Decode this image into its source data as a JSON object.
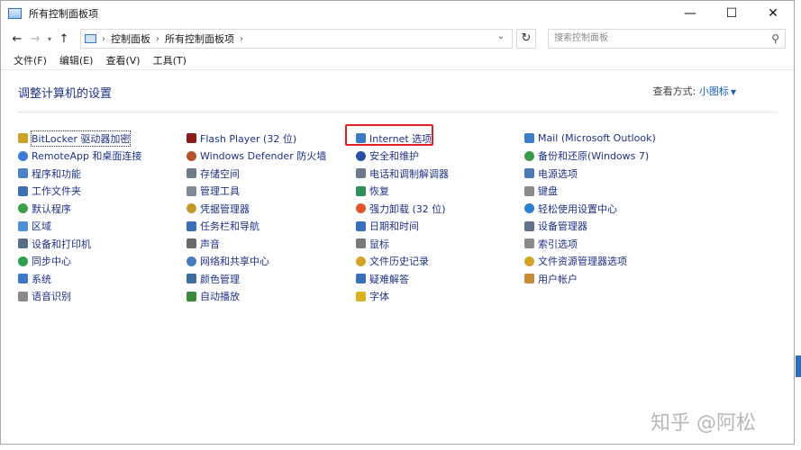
{
  "window": {
    "title": "所有控制面板项"
  },
  "nav": {
    "breadcrumb": [
      "控制面板",
      "所有控制面板项"
    ],
    "search_placeholder": "搜索控制面板"
  },
  "menu": [
    "文件(F)",
    "编辑(E)",
    "查看(V)",
    "工具(T)"
  ],
  "main": {
    "heading": "调整计算机的设置",
    "view_by_label": "查看方式:",
    "view_by_value": "小图标"
  },
  "columns": [
    [
      "BitLocker 驱动器加密",
      "RemoteApp 和桌面连接",
      "程序和功能",
      "工作文件夹",
      "默认程序",
      "区域",
      "设备和打印机",
      "同步中心",
      "系统",
      "语音识别"
    ],
    [
      "Flash Player (32 位)",
      "Windows Defender 防火墙",
      "存储空间",
      "管理工具",
      "凭据管理器",
      "任务栏和导航",
      "声音",
      "网络和共享中心",
      "颜色管理",
      "自动播放"
    ],
    [
      "Internet 选项",
      "安全和维护",
      "电话和调制解调器",
      "恢复",
      "强力卸载 (32 位)",
      "日期和时间",
      "鼠标",
      "文件历史记录",
      "疑难解答",
      "字体"
    ],
    [
      "Mail (Microsoft Outlook)",
      "备份和还原(Windows 7)",
      "电源选项",
      "键盘",
      "轻松使用设置中心",
      "设备管理器",
      "索引选项",
      "文件资源管理器选项",
      "用户帐户"
    ]
  ],
  "icons": [
    [
      "bitlocker-icon",
      "remoteapp-icon",
      "programs-icon",
      "work-folders-icon",
      "default-programs-icon",
      "region-icon",
      "devices-printers-icon",
      "sync-center-icon",
      "system-icon",
      "speech-recognition-icon"
    ],
    [
      "flash-icon",
      "firewall-icon",
      "storage-spaces-icon",
      "admin-tools-icon",
      "credential-icon",
      "taskbar-icon",
      "sound-icon",
      "network-icon",
      "color-management-icon",
      "autoplay-icon"
    ],
    [
      "internet-options-icon",
      "security-flag-icon",
      "phone-modem-icon",
      "recovery-icon",
      "uninstall-icon",
      "clock-icon",
      "mouse-icon",
      "file-history-icon",
      "troubleshoot-icon",
      "fonts-icon"
    ],
    [
      "mail-icon",
      "backup-icon",
      "power-icon",
      "keyboard-icon",
      "ease-of-access-icon",
      "device-manager-icon",
      "index-options-icon",
      "folder-options-icon",
      "user-accounts-icon"
    ]
  ],
  "icon_colors": [
    [
      "#c9a227",
      "#3a7bd5",
      "#4b82c8",
      "#3d6fb6",
      "#3aa14a",
      "#4f8fd6",
      "#5a6e86",
      "#2e9e4f",
      "#3d79c8",
      "#8a8a8a"
    ],
    [
      "#8b1c1c",
      "#b5532a",
      "#6f7b8a",
      "#7d8b99",
      "#c49a2c",
      "#3b6fb5",
      "#6a6a6a",
      "#4a7dc0",
      "#3d6e9e",
      "#3c8a3c"
    ],
    [
      "#3b7ac9",
      "#2a4fa3",
      "#6b7a8a",
      "#2f8f5a",
      "#e0552a",
      "#3a6fc0",
      "#7a7a7a",
      "#d4a32a",
      "#3a70b8",
      "#d9b21f"
    ],
    [
      "#3c7fc8",
      "#3a9a4a",
      "#4a7ab8",
      "#8a8a8a",
      "#2f7fd0",
      "#5f7088",
      "#8a8a8a",
      "#d4a32a",
      "#c98a3a"
    ]
  ],
  "highlight_item": "Internet 选项",
  "watermark": "知乎 @阿松",
  "window_buttons": [
    "—",
    "☐",
    "✕"
  ]
}
